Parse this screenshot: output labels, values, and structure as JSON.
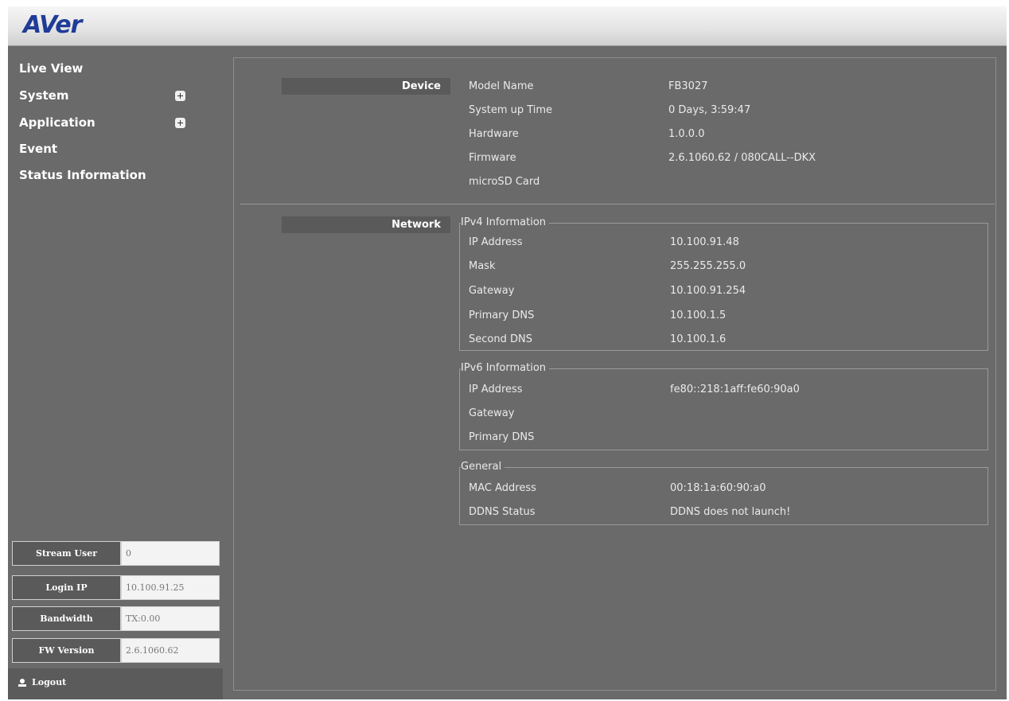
{
  "header": {
    "logo_text": "AVer"
  },
  "sidebar": {
    "nav": [
      {
        "label": "Live View",
        "expandable": false
      },
      {
        "label": "System",
        "expandable": true
      },
      {
        "label": "Application",
        "expandable": true
      },
      {
        "label": "Event",
        "expandable": false
      },
      {
        "label": "Status Information",
        "expandable": false
      }
    ],
    "info": [
      {
        "label": "Stream User",
        "value": "0"
      },
      {
        "label": "Login IP",
        "value": "10.100.91.25"
      },
      {
        "label": "Bandwidth",
        "value": "TX:0.00"
      },
      {
        "label": "FW Version",
        "value": "2.6.1060.62"
      }
    ],
    "logout_label": "Logout"
  },
  "device": {
    "section_label": "Device",
    "rows": [
      {
        "label": "Model Name",
        "value": "FB3027"
      },
      {
        "label": "System up Time",
        "value": "0 Days, 3:59:47"
      },
      {
        "label": "Hardware",
        "value": "1.0.0.0"
      },
      {
        "label": "Firmware",
        "value": "2.6.1060.62 / 080CALL--DKX"
      },
      {
        "label": "microSD Card",
        "value": ""
      }
    ]
  },
  "network": {
    "section_label": "Network",
    "ipv4": {
      "legend": "IPv4 Information",
      "rows": [
        {
          "label": "IP Address",
          "value": "10.100.91.48"
        },
        {
          "label": "Mask",
          "value": "255.255.255.0"
        },
        {
          "label": "Gateway",
          "value": "10.100.91.254"
        },
        {
          "label": "Primary DNS",
          "value": "10.100.1.5"
        },
        {
          "label": "Second DNS",
          "value": "10.100.1.6"
        }
      ]
    },
    "ipv6": {
      "legend": "IPv6 Information",
      "rows": [
        {
          "label": "IP Address",
          "value": "fe80::218:1aff:fe60:90a0"
        },
        {
          "label": "Gateway",
          "value": ""
        },
        {
          "label": "Primary DNS",
          "value": ""
        }
      ]
    },
    "general": {
      "legend": "General",
      "rows": [
        {
          "label": "MAC Address",
          "value": "00:18:1a:60:90:a0"
        },
        {
          "label": "DDNS Status",
          "value": "DDNS does not launch!"
        }
      ]
    }
  },
  "colors": {
    "panel_bg": "#6a6a6a",
    "label_bg": "#5a5a5a",
    "logo_blue": "#1f3c96"
  }
}
